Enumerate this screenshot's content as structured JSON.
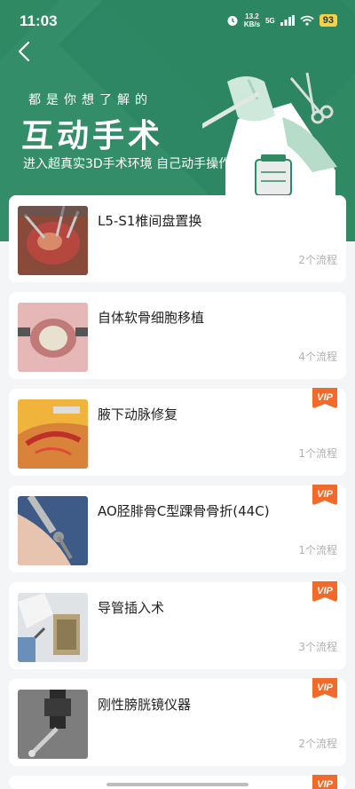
{
  "status": {
    "time": "11:03",
    "speed_value": "13.2",
    "speed_unit": "KB/s",
    "network": "5G",
    "battery": "93"
  },
  "hero": {
    "subtitle": "都是你想了解的",
    "title": "互动手术",
    "description": "进入超真实3D手术环境 自己动手操作"
  },
  "vip_label": "VIP",
  "procedures": [
    {
      "title": "L5-S1椎间盘置换",
      "flows": "2个流程",
      "vip": false
    },
    {
      "title": "自体软骨细胞移植",
      "flows": "4个流程",
      "vip": false
    },
    {
      "title": "腋下动脉修复",
      "flows": "1个流程",
      "vip": true
    },
    {
      "title": "AO胫腓骨C型踝骨骨折(44C)",
      "flows": "1个流程",
      "vip": true
    },
    {
      "title": "导管插入术",
      "flows": "3个流程",
      "vip": true
    },
    {
      "title": "刚性膀胱镜仪器",
      "flows": "2个流程",
      "vip": true
    }
  ]
}
